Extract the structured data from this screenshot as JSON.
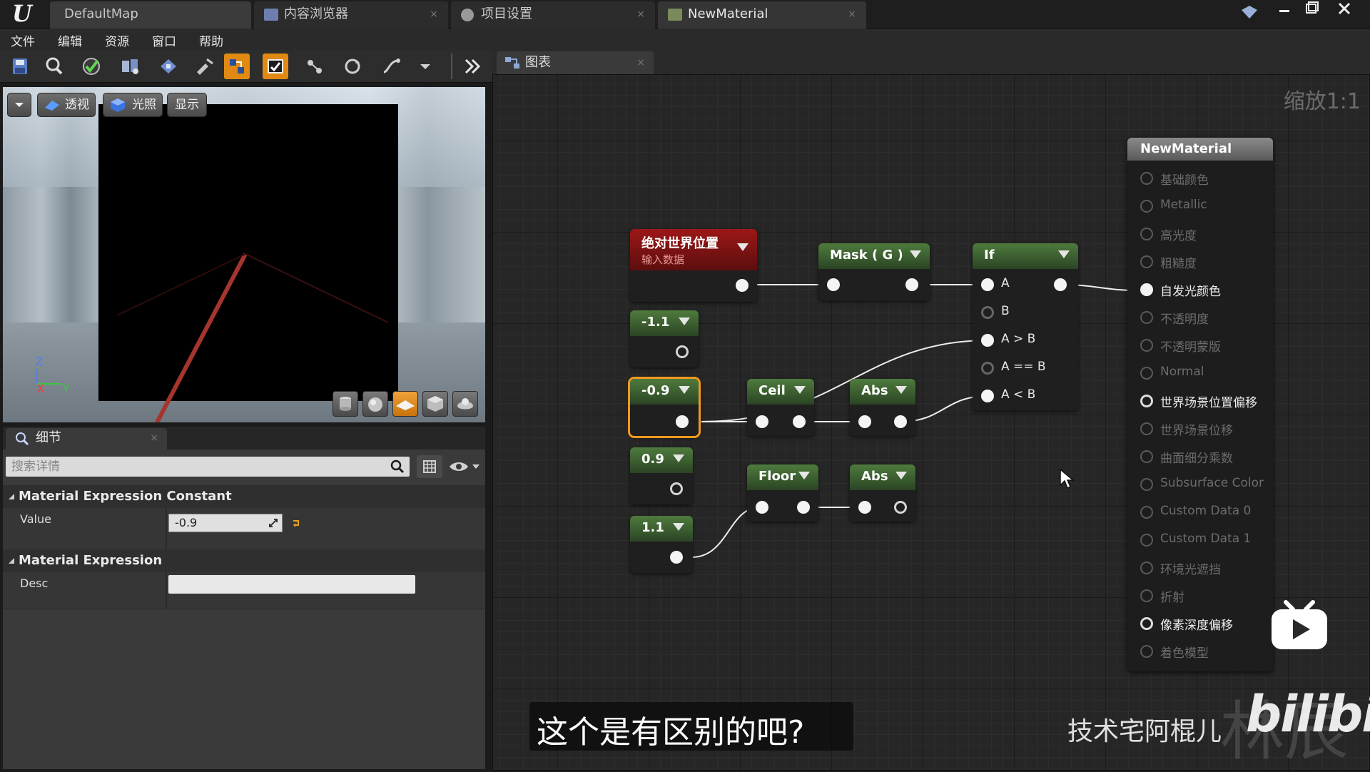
{
  "titlebar": {
    "tabs": [
      {
        "label": "DefaultMap"
      },
      {
        "label": "内容浏览器"
      },
      {
        "label": "项目设置"
      },
      {
        "label": "NewMaterial"
      }
    ],
    "close_glyph": "×"
  },
  "menu": {
    "items": [
      "文件",
      "编辑",
      "资源",
      "窗口",
      "帮助"
    ]
  },
  "viewport": {
    "buttons": {
      "perspective": "透视",
      "lighting": "光照",
      "show": "显示"
    },
    "axes": {
      "z": "Z",
      "x": "X",
      "y": "Y"
    }
  },
  "details": {
    "tab_label": "细节",
    "search_placeholder": "搜索详情",
    "categories": [
      {
        "title": "Material Expression Constant",
        "props": [
          {
            "label": "Value",
            "value": "-0.9"
          }
        ]
      },
      {
        "title": "Material Expression",
        "props": [
          {
            "label": "Desc",
            "value": ""
          }
        ]
      }
    ]
  },
  "graph": {
    "tab_label": "图表",
    "zoom": "缩放1:1",
    "nodes": {
      "world_pos": {
        "title": "绝对世界位置",
        "subtitle": "输入数据"
      },
      "mask": {
        "title": "Mask ( G )"
      },
      "if": {
        "title": "If",
        "pins": [
          "A",
          "B",
          "A > B",
          "A == B",
          "A < B"
        ]
      },
      "c1": {
        "title": "-1.1"
      },
      "c2": {
        "title": "-0.9"
      },
      "c3": {
        "title": "0.9"
      },
      "c4": {
        "title": "1.1"
      },
      "ceil": {
        "title": "Ceil"
      },
      "abs1": {
        "title": "Abs"
      },
      "floor": {
        "title": "Floor"
      },
      "abs2": {
        "title": "Abs"
      }
    },
    "output": {
      "title": "NewMaterial",
      "inputs": [
        "基础颜色",
        "Metallic",
        "高光度",
        "粗糙度",
        "自发光颜色",
        "不透明度",
        "不透明蒙版",
        "Normal",
        "世界场景位置偏移",
        "世界场景位移",
        "曲面细分乘数",
        "Subsurface Color",
        "Custom Data 0",
        "Custom Data 1",
        "环境光遮挡",
        "折射",
        "像素深度偏移",
        "着色模型"
      ]
    }
  },
  "overlay": {
    "subtitle": "这个是有区别的吧?",
    "author": "技术宅阿棍儿",
    "logo": "bilibili",
    "bg_text": "林辰"
  },
  "colors": {
    "accent": "#e08a13",
    "node_green": "#4f7b3d",
    "node_red": "#9d1717",
    "selection": "#f29a1f"
  }
}
